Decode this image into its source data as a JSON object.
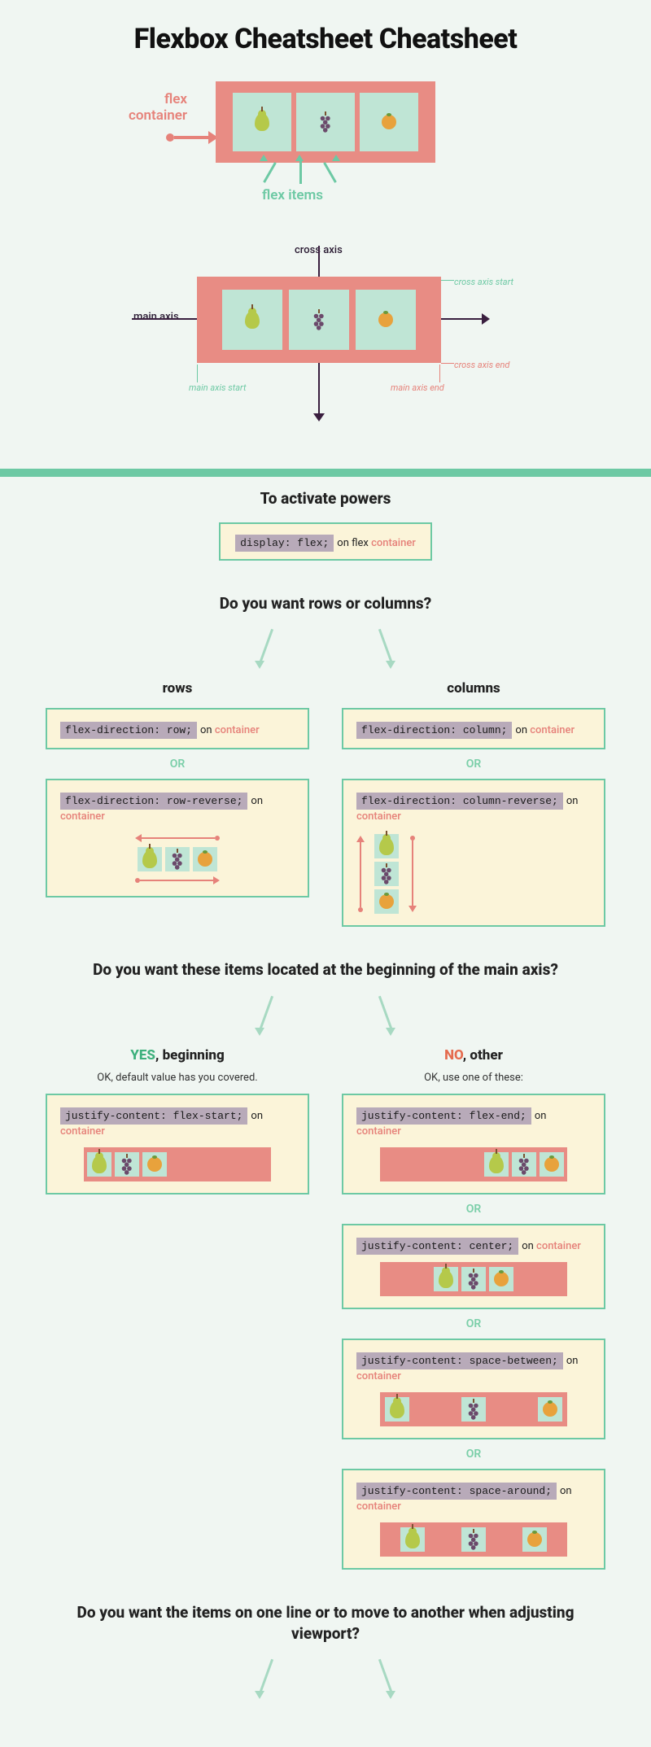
{
  "title": "Flexbox Cheatsheet Cheatsheet",
  "top": {
    "flex_container_label": "flex\ncontainer",
    "flex_items_label": "flex items",
    "cross_axis": "cross axis",
    "main_axis": "main axis",
    "cross_axis_start": "cross axis start",
    "cross_axis_end": "cross axis end",
    "main_axis_start": "main axis start",
    "main_axis_end": "main axis end"
  },
  "activate": {
    "heading": "To activate powers",
    "code": "display: flex;",
    "on_text": " on flex ",
    "on_acc": "container"
  },
  "rows_cols": {
    "heading": "Do you want rows or columns?",
    "rows_label": "rows",
    "columns_label": "columns",
    "row_code": "flex-direction: row;",
    "col_code": "flex-direction: column;",
    "row_rev_code": "flex-direction: row-reverse;",
    "col_rev_code": "flex-direction: column-reverse;",
    "or": "OR",
    "on": " on ",
    "container": "container"
  },
  "justify": {
    "heading": "Do you want these items located at the beginning of the main axis?",
    "yes": "YES",
    "yes_suffix": ",  beginning",
    "no": "NO",
    "no_suffix": ", other",
    "yes_sub": "OK, default value has you covered.",
    "no_sub": "OK, use one of these:",
    "c_start": "justify-content: flex-start;",
    "c_end": "justify-content: flex-end;",
    "c_center": "justify-content: center;",
    "c_between": "justify-content: space-between;",
    "c_around": "justify-content: space-around;",
    "or": "OR",
    "on": " on ",
    "container": "container"
  },
  "wrap": {
    "heading": "Do you want the items on one line or to move to another when adjusting viewport?"
  }
}
